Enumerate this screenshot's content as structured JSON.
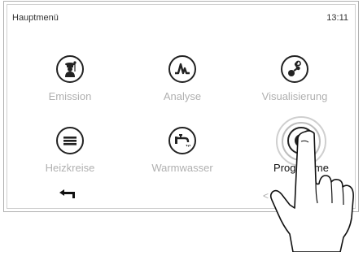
{
  "header": {
    "title": "Hauptmenü",
    "time": "13:11"
  },
  "menu": [
    {
      "label": "Emission",
      "icon": "chimney-sweep-icon",
      "active": false
    },
    {
      "label": "Analyse",
      "icon": "waveform-icon",
      "active": false
    },
    {
      "label": "Visualisierung",
      "icon": "flow-visualization-icon",
      "active": false
    },
    {
      "label": "Heizkreise",
      "icon": "radiator-icon",
      "active": false
    },
    {
      "label": "Warmwasser",
      "icon": "faucet-icon",
      "active": false
    },
    {
      "label": "Programme",
      "icon": "program-gauge-icon",
      "active": true
    }
  ],
  "footer": {
    "back_icon": "back-arrow-icon",
    "prev_icon": "chevron-left-icon",
    "prev_glyph": "<"
  },
  "overlay": {
    "pointer": "pointing-hand-icon"
  }
}
